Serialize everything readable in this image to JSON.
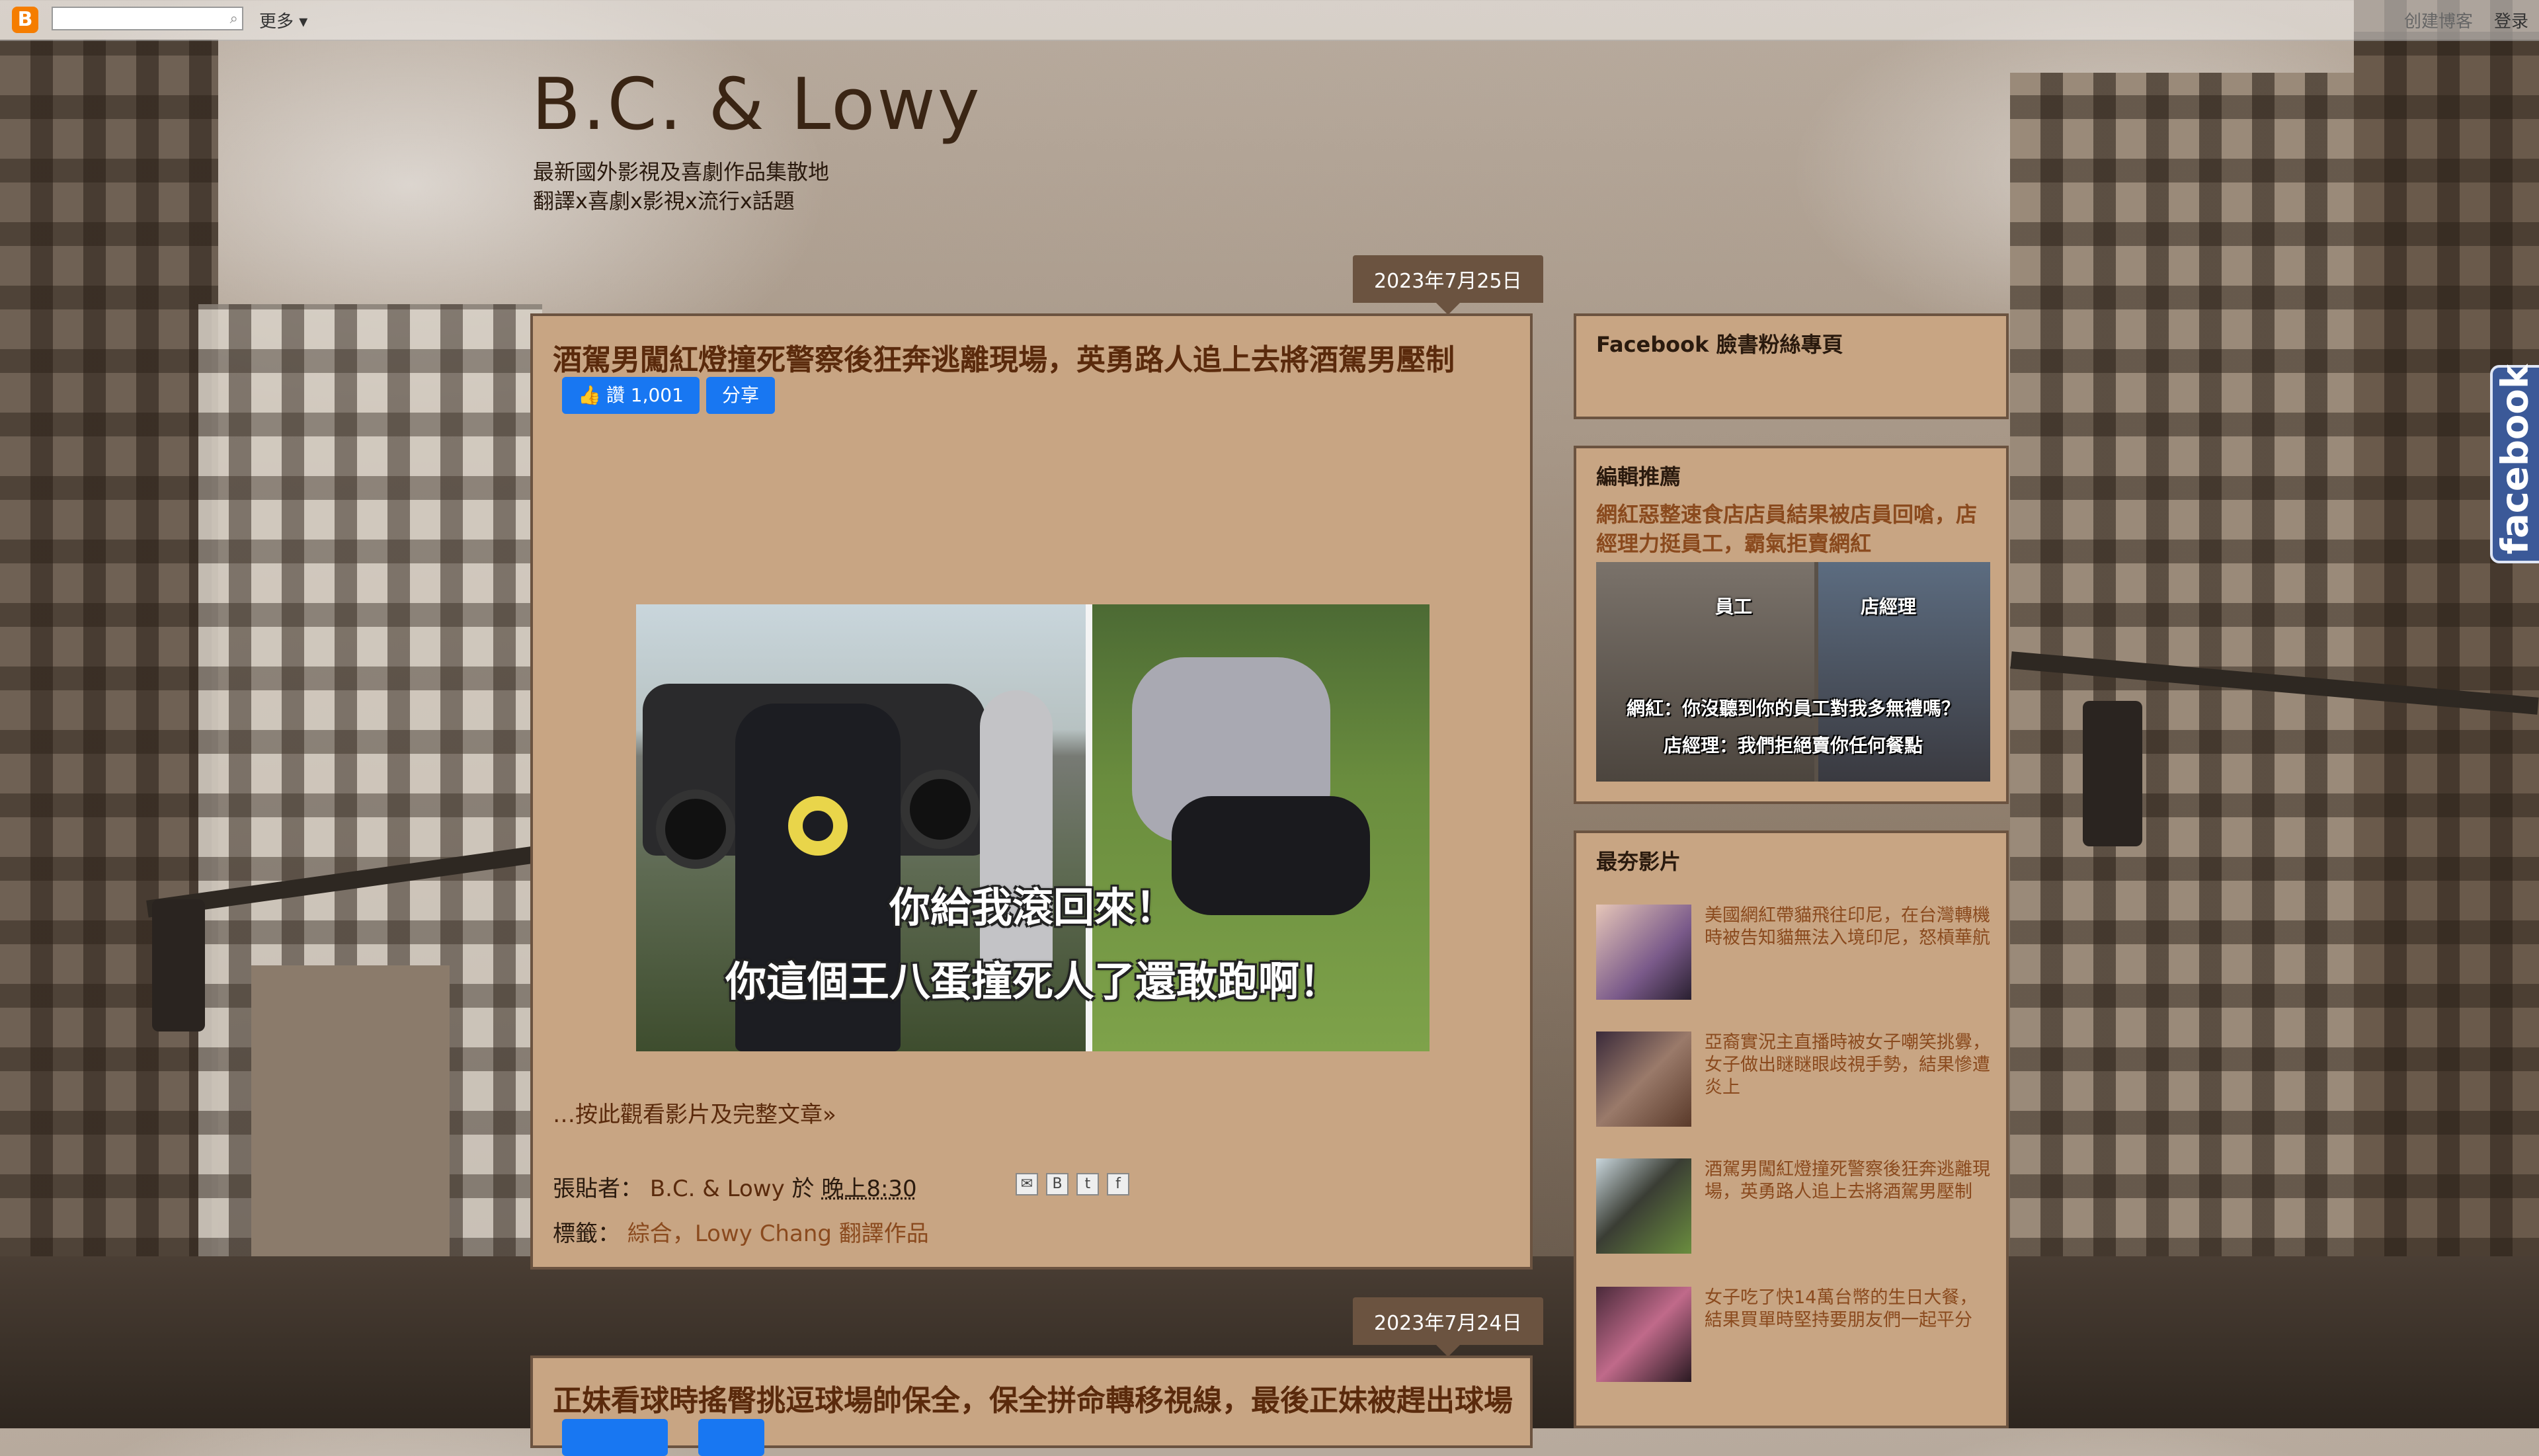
{
  "navbar": {
    "logo": "B",
    "more_label": "更多 ▾",
    "create_label": "创建博客",
    "login_label": "登录"
  },
  "header": {
    "title": "B.C. & Lowy",
    "desc_line1": "最新國外影視及喜劇作品集散地",
    "desc_line2": "翻譯x喜劇x影視x流行x話題"
  },
  "posts": [
    {
      "date": "2023年7月25日",
      "title": "酒駕男闖紅燈撞死警察後狂奔逃離現場，英勇路人追上去將酒駕男壓制",
      "like_label": "讚 1,001",
      "share_label": "分享",
      "subtitle1": "你給我滾回來！",
      "subtitle2": "你這個王八蛋撞死人了還敢跑啊！",
      "read_more": "…按此觀看影片及完整文章»",
      "posted_by_label": "張貼者：",
      "author": "B.C. & Lowy",
      "at_label": "於",
      "time": "晚上8:30",
      "labels_label": "標籤：",
      "label1": "綜合",
      "label_sep": "，",
      "label2": "Lowy Chang 翻譯作品"
    },
    {
      "date": "2023年7月24日",
      "title": "正妹看球時搖臀挑逗球場帥保全，保全拼命轉移視線，最後正妹被趕出球場"
    }
  ],
  "sidebar": {
    "fb_page_title": "Facebook 臉書粉絲專頁",
    "featured": {
      "title": "編輯推薦",
      "link": "網紅惡整速食店店員結果被店員回嗆，店經理力挺員工，霸氣拒賣網紅",
      "label_staff": "員工",
      "label_manager": "店經理",
      "sub1": "網紅：你沒聽到你的員工對我多無禮嗎？",
      "sub2": "店經理：我們拒絕賣你任何餐點"
    },
    "popular": {
      "title": "最夯影片",
      "items": [
        "美國網紅帶貓飛往印尼，在台灣轉機時被告知貓無法入境印尼，怒槓華航",
        "亞裔實況主直播時被女子嘲笑挑釁，女子做出瞇瞇眼歧視手勢，結果慘遭炎上",
        "酒駕男闖紅燈撞死警察後狂奔逃離現場，英勇路人追上去將酒駕男壓制",
        "女子吃了快14萬台幣的生日大餐，結果買單時堅持要朋友們一起平分"
      ]
    }
  },
  "fb_tab": "facebook",
  "colors": {
    "post_bg": "#c8a583",
    "post_border": "#6b5340",
    "title_color": "#5a2a0c",
    "link_color": "#8a4a1e",
    "fb_blue": "#1877f2"
  }
}
